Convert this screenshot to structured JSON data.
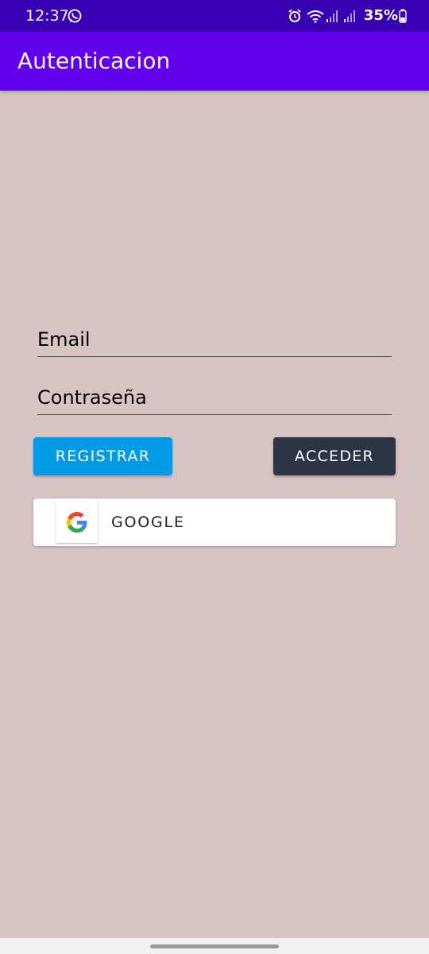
{
  "status_bar": {
    "time": "12:37",
    "battery": "35%",
    "icons": [
      "whatsapp-icon",
      "alarm-icon",
      "wifi-icon",
      "signal-icon",
      "signal-icon",
      "battery-icon"
    ],
    "background": "#3700b3"
  },
  "app_bar": {
    "title": "Autenticacion",
    "background": "#6200ee"
  },
  "form": {
    "email_label": "Email",
    "password_label": "Contraseña",
    "register_label": "REGISTRAR",
    "login_label": "ACCEDER",
    "google_label": "GOOGLE"
  },
  "colors": {
    "page_background": "#d9c4c4",
    "register_button": "#039be5",
    "login_button": "#2c3545"
  }
}
